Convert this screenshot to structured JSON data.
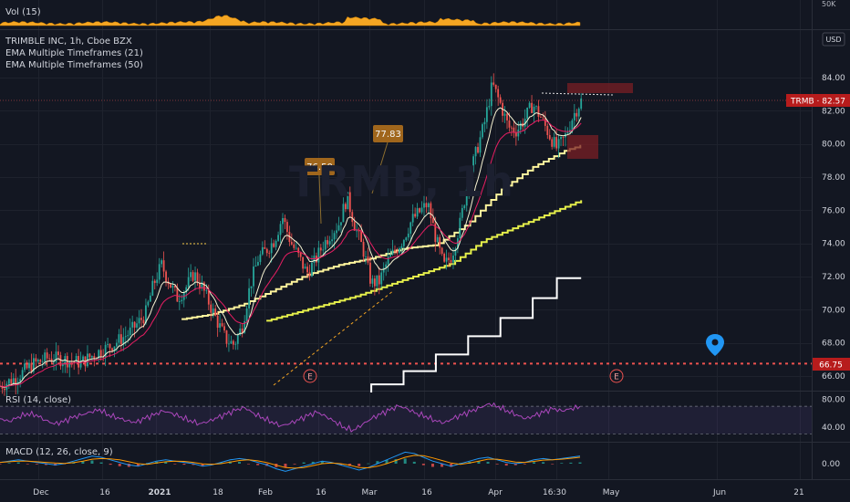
{
  "colors": {
    "background": "#131722",
    "grid": "#1e222d",
    "text": "#d1d4dc",
    "candle_up": "#26a69a",
    "candle_down": "#ef5350",
    "ema_fast": "#f7f3d2",
    "ema_mid": "#e91e63",
    "ema_mtf21": "#fff59d",
    "ema_mtf50": "#e6f04b",
    "ema_daily": "#ffffff",
    "volume": "#f5a623",
    "rsi": "#ab47bc",
    "macd": "#2196f3",
    "signal": "#ff9800",
    "support_line": "#ef5350",
    "price_badge": "#b71c1c",
    "pin": "#2196f3"
  },
  "volume_pane": {
    "label": "Vol (15)",
    "axis_label": "50K"
  },
  "main_pane": {
    "symbol_line": "TRIMBLE INC, 1h, Cboe BZX",
    "indicator_1": "EMA Multiple Timeframes (21)",
    "indicator_2": "EMA Multiple Timeframes (50)",
    "currency_button": "USD",
    "last_price_badge": "TRMB · 82.57",
    "support_badge": "66.75",
    "event_marker": "E",
    "callout_1": "76.50",
    "callout_2": "77.83",
    "pin_icon": "map-pin-icon"
  },
  "rsi_pane": {
    "label": "RSI (14, close)",
    "upper_level": 70,
    "lower_level": 30
  },
  "macd_pane": {
    "label": "MACD (12, 26, close, 9)"
  },
  "time_axis_labels": [
    "Dec",
    "16",
    "2021",
    "18",
    "Feb",
    "16",
    "Mar",
    "16",
    "Apr",
    "16:30",
    "May",
    "Jun",
    "21"
  ],
  "chart_data": {
    "type": "line",
    "title": "TRIMBLE INC, 1h, Cboe BZX",
    "series_names": [
      "TRMB",
      "EMA Multiple Timeframes (21)",
      "EMA Multiple Timeframes (50)"
    ],
    "price_axis_ticks": [
      84.0,
      82.0,
      80.0,
      78.0,
      76.0,
      74.0,
      72.0,
      70.0,
      68.0,
      66.0
    ],
    "price_axis_labels": [
      "84.00",
      "82.00",
      "80.00",
      "78.00",
      "76.00",
      "74.00",
      "72.00",
      "70.00",
      "68.00",
      "66.00"
    ],
    "ylim": [
      65.5,
      85.0
    ],
    "last_price": 82.57,
    "support_level": 66.75,
    "callouts": [
      76.5,
      77.83
    ],
    "price_path_keypoints": [
      [
        0.0,
        65.4
      ],
      [
        0.02,
        65.9
      ],
      [
        0.04,
        66.7
      ],
      [
        0.06,
        67.1
      ],
      [
        0.08,
        67.0
      ],
      [
        0.1,
        66.8
      ],
      [
        0.12,
        67.4
      ],
      [
        0.14,
        67.9
      ],
      [
        0.16,
        68.6
      ],
      [
        0.18,
        69.7
      ],
      [
        0.19,
        71.5
      ],
      [
        0.2,
        72.7
      ],
      [
        0.21,
        71.6
      ],
      [
        0.22,
        70.7
      ],
      [
        0.23,
        71.3
      ],
      [
        0.24,
        72.2
      ],
      [
        0.25,
        71.4
      ],
      [
        0.26,
        70.3
      ],
      [
        0.27,
        69.2
      ],
      [
        0.28,
        68.2
      ],
      [
        0.29,
        67.9
      ],
      [
        0.3,
        69.0
      ],
      [
        0.31,
        71.5
      ],
      [
        0.32,
        73.1
      ],
      [
        0.33,
        73.6
      ],
      [
        0.34,
        74.2
      ],
      [
        0.35,
        75.6
      ],
      [
        0.36,
        74.1
      ],
      [
        0.37,
        73.2
      ],
      [
        0.38,
        72.2
      ],
      [
        0.39,
        72.9
      ],
      [
        0.4,
        73.9
      ],
      [
        0.41,
        74.6
      ],
      [
        0.42,
        75.2
      ],
      [
        0.43,
        76.8
      ],
      [
        0.44,
        75.0
      ],
      [
        0.45,
        73.6
      ],
      [
        0.46,
        71.6
      ],
      [
        0.47,
        71.7
      ],
      [
        0.48,
        72.9
      ],
      [
        0.49,
        73.6
      ],
      [
        0.5,
        74.3
      ],
      [
        0.51,
        75.4
      ],
      [
        0.52,
        75.9
      ],
      [
        0.53,
        76.4
      ],
      [
        0.54,
        74.3
      ],
      [
        0.55,
        72.6
      ],
      [
        0.56,
        73.3
      ],
      [
        0.57,
        75.2
      ],
      [
        0.58,
        77.8
      ],
      [
        0.59,
        79.5
      ],
      [
        0.6,
        81.2
      ],
      [
        0.61,
        83.6
      ],
      [
        0.62,
        82.4
      ],
      [
        0.63,
        81.0
      ],
      [
        0.64,
        80.8
      ],
      [
        0.65,
        81.5
      ],
      [
        0.66,
        82.4
      ],
      [
        0.67,
        81.6
      ],
      [
        0.68,
        80.6
      ],
      [
        0.69,
        79.7
      ],
      [
        0.7,
        80.4
      ],
      [
        0.71,
        81.7
      ],
      [
        0.72,
        82.6
      ]
    ],
    "ema21_mtf_keypoints": [
      [
        0.07,
        66.0
      ],
      [
        0.1,
        67.2
      ],
      [
        0.14,
        67.9
      ],
      [
        0.18,
        68.8
      ],
      [
        0.22,
        69.4
      ],
      [
        0.26,
        69.7
      ],
      [
        0.3,
        70.3
      ],
      [
        0.34,
        71.2
      ],
      [
        0.38,
        72.1
      ],
      [
        0.42,
        72.7
      ],
      [
        0.46,
        73.1
      ],
      [
        0.5,
        73.7
      ],
      [
        0.54,
        73.9
      ],
      [
        0.58,
        75.2
      ],
      [
        0.62,
        77.2
      ],
      [
        0.66,
        78.6
      ],
      [
        0.7,
        79.6
      ],
      [
        0.72,
        79.9
      ]
    ],
    "ema50_mtf_keypoints": [
      [
        0.08,
        65.5
      ],
      [
        0.14,
        66.5
      ],
      [
        0.2,
        67.6
      ],
      [
        0.26,
        68.4
      ],
      [
        0.32,
        69.2
      ],
      [
        0.38,
        70.0
      ],
      [
        0.44,
        70.8
      ],
      [
        0.5,
        71.8
      ],
      [
        0.56,
        72.8
      ],
      [
        0.6,
        74.2
      ],
      [
        0.66,
        75.4
      ],
      [
        0.72,
        76.6
      ]
    ],
    "ema_daily_steps": [
      [
        0.46,
        65.5
      ],
      [
        0.5,
        66.3
      ],
      [
        0.54,
        67.3
      ],
      [
        0.58,
        68.4
      ],
      [
        0.62,
        69.5
      ],
      [
        0.66,
        70.7
      ],
      [
        0.69,
        71.9
      ]
    ],
    "rsi_ylim": [
      20,
      90
    ],
    "rsi_axis_labels": [
      "80.00",
      "40.00"
    ],
    "rsi_values": [
      52,
      48,
      55,
      60,
      58,
      50,
      44,
      47,
      53,
      57,
      62,
      66,
      58,
      54,
      49,
      46,
      52,
      57,
      63,
      60,
      55,
      50,
      45,
      48,
      53,
      58,
      64,
      68,
      60,
      54,
      48,
      42,
      45,
      50,
      56,
      61,
      55,
      48,
      40,
      36,
      44,
      52,
      58,
      64,
      70,
      66,
      60,
      56,
      50,
      46,
      52,
      57,
      62,
      68,
      74,
      70,
      64,
      58,
      52,
      56,
      61,
      66,
      63,
      67,
      70
    ],
    "macd_axis_label": "0.00",
    "macd_values": [
      0.1,
      0.2,
      0.3,
      0.2,
      0.1,
      0.0,
      -0.1,
      0.0,
      0.2,
      0.4,
      0.6,
      0.5,
      0.3,
      0.1,
      -0.1,
      -0.2,
      0.0,
      0.2,
      0.3,
      0.2,
      0.1,
      0.0,
      -0.2,
      -0.1,
      0.1,
      0.3,
      0.4,
      0.3,
      0.1,
      -0.1,
      -0.4,
      -0.6,
      -0.4,
      -0.2,
      0.0,
      0.2,
      0.1,
      -0.1,
      -0.3,
      -0.5,
      -0.3,
      0.0,
      0.3,
      0.6,
      0.9,
      0.8,
      0.5,
      0.2,
      0.0,
      -0.2,
      0.0,
      0.2,
      0.4,
      0.5,
      0.3,
      0.1,
      0.0,
      0.1,
      0.3,
      0.4,
      0.3,
      0.4,
      0.5,
      0.6
    ],
    "signal_values": [
      0.1,
      0.15,
      0.2,
      0.2,
      0.15,
      0.1,
      0.05,
      0.02,
      0.08,
      0.2,
      0.35,
      0.4,
      0.38,
      0.3,
      0.15,
      0.0,
      -0.05,
      0.05,
      0.15,
      0.2,
      0.18,
      0.1,
      -0.02,
      -0.06,
      0.0,
      0.12,
      0.25,
      0.3,
      0.22,
      0.08,
      -0.12,
      -0.3,
      -0.35,
      -0.3,
      -0.15,
      0.0,
      0.05,
      0.0,
      -0.12,
      -0.3,
      -0.32,
      -0.2,
      0.0,
      0.25,
      0.5,
      0.65,
      0.62,
      0.45,
      0.25,
      0.05,
      -0.05,
      0.05,
      0.2,
      0.35,
      0.35,
      0.25,
      0.12,
      0.1,
      0.18,
      0.28,
      0.3,
      0.35,
      0.42,
      0.5
    ]
  }
}
